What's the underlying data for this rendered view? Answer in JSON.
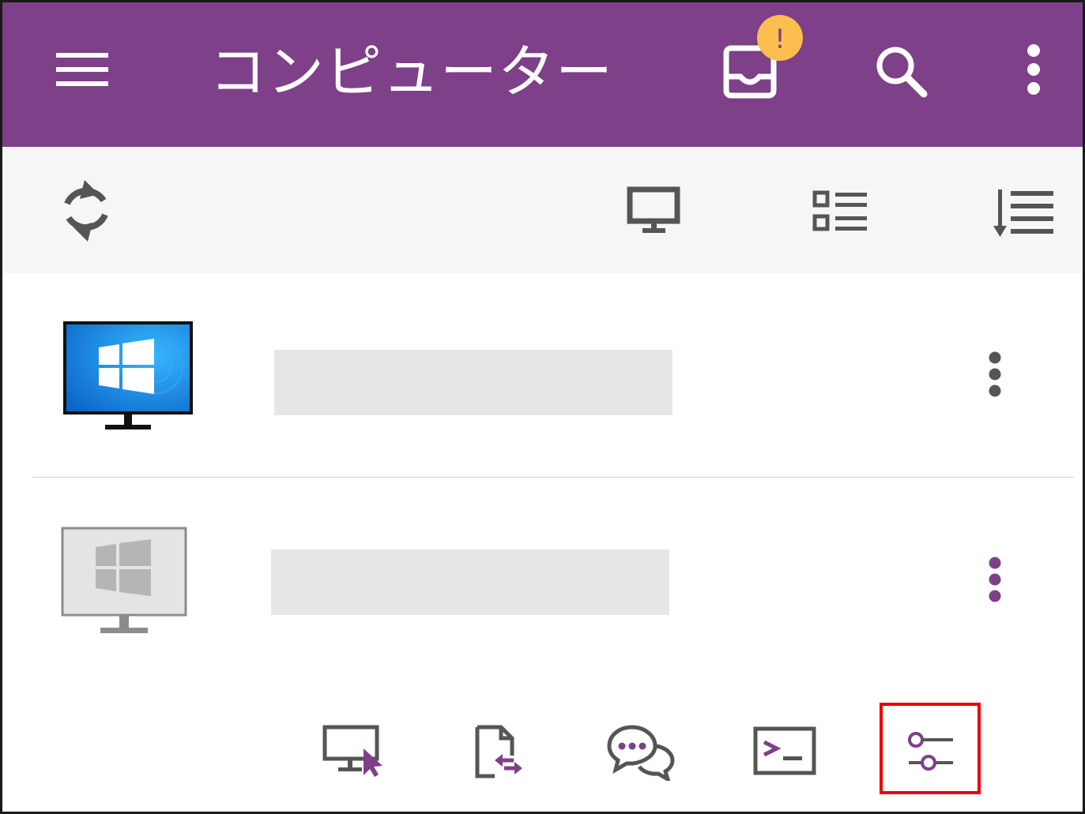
{
  "app_bar": {
    "title": "コンピューター",
    "background_color": "#7d4089",
    "icons": [
      "menu-icon",
      "inbox-icon",
      "search-icon",
      "more-vert-icon"
    ],
    "notification_badge": {
      "text": "!",
      "color": "#fbbe4f"
    }
  },
  "toolbar": {
    "icons": [
      "refresh-icon",
      "monitor-icon",
      "list-view-icon",
      "sort-icon"
    ]
  },
  "computers": [
    {
      "icon": "windows-monitor-online-icon",
      "name": "",
      "status": "online"
    },
    {
      "icon": "windows-monitor-offline-icon",
      "name": "",
      "status": "offline"
    }
  ],
  "actions": {
    "icons": [
      "remote-control-icon",
      "file-transfer-icon",
      "chat-icon",
      "terminal-icon",
      "settings-sliders-icon"
    ],
    "accent_color": "#7d4089",
    "highlighted": "settings-sliders-icon",
    "highlight_color": "#e8000b"
  }
}
